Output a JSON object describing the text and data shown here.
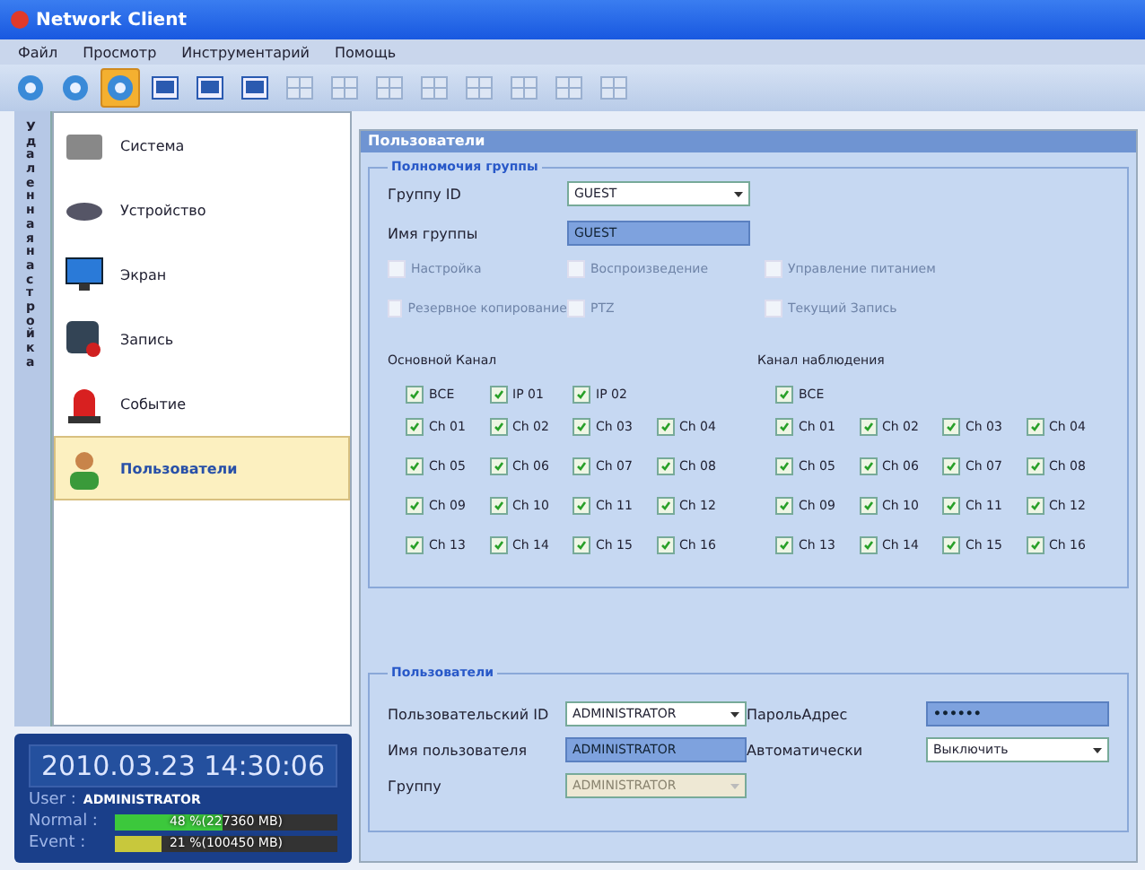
{
  "window": {
    "title": "Network Client"
  },
  "menu": [
    "Файл",
    "Просмотр",
    "Инструментарий",
    "Помощь"
  ],
  "toolbar": [
    {
      "kind": "main",
      "selected": false
    },
    {
      "kind": "main",
      "selected": false
    },
    {
      "kind": "main",
      "selected": true
    },
    {
      "kind": "view",
      "selected": false
    },
    {
      "kind": "view",
      "selected": false
    },
    {
      "kind": "view",
      "selected": false
    },
    {
      "kind": "layout",
      "selected": false
    },
    {
      "kind": "layout",
      "selected": false
    },
    {
      "kind": "layout",
      "selected": false
    },
    {
      "kind": "layout",
      "selected": false
    },
    {
      "kind": "layout",
      "selected": false
    },
    {
      "kind": "layout",
      "selected": false
    },
    {
      "kind": "layout",
      "selected": false
    },
    {
      "kind": "layout",
      "selected": false
    }
  ],
  "side_tab": {
    "label": "Удаленная настройка"
  },
  "sidebar": {
    "items": [
      {
        "label": "Система",
        "kind": "system",
        "selected": false
      },
      {
        "label": "Устройство",
        "kind": "device",
        "selected": false
      },
      {
        "label": "Экран",
        "kind": "screen",
        "selected": false
      },
      {
        "label": "Запись",
        "kind": "record",
        "selected": false
      },
      {
        "label": "Событие",
        "kind": "event",
        "selected": false
      },
      {
        "label": "Пользователи",
        "kind": "user",
        "selected": true
      }
    ]
  },
  "status": {
    "datetime": "2010.03.23  14:30:06",
    "user_label": "User :",
    "user": "ADMINISTRATOR",
    "meters": [
      {
        "label": "Normal :",
        "reading": "48 %(227360 MB)",
        "level": 0.48,
        "color": "#3cc83c"
      },
      {
        "label": "Event   :",
        "reading": "21 %(100450 MB)",
        "level": 0.21,
        "color": "#c8c83c"
      }
    ]
  },
  "panel": {
    "title": "Пользователи",
    "group": {
      "title": "Полномочия группы",
      "group_id": {
        "label": "Группу ID",
        "value": "GUEST"
      },
      "group_name": {
        "label": "Имя группы",
        "value": "GUEST"
      },
      "permissions": [
        {
          "label": "Настройка",
          "checked": false,
          "disabled": true
        },
        {
          "label": "Воспроизведение",
          "checked": false,
          "disabled": true
        },
        {
          "label": "Управление питанием",
          "checked": false,
          "disabled": true
        },
        {
          "label": "Резервное копирование",
          "checked": false,
          "disabled": true
        },
        {
          "label": "PTZ",
          "checked": false,
          "disabled": true
        },
        {
          "label": "Текущий Запись",
          "checked": false,
          "disabled": true
        }
      ],
      "channel_sets": [
        {
          "title": "Основной Канал",
          "top": [
            {
              "label": "ВСЕ",
              "checked": true
            },
            {
              "label": "IP 01",
              "checked": true
            },
            {
              "label": "IP 02",
              "checked": true
            }
          ],
          "channels": [
            {
              "label": "Ch 01",
              "checked": true
            },
            {
              "label": "Ch 02",
              "checked": true
            },
            {
              "label": "Ch 03",
              "checked": true
            },
            {
              "label": "Ch 04",
              "checked": true
            },
            {
              "label": "Ch 05",
              "checked": true
            },
            {
              "label": "Ch 06",
              "checked": true
            },
            {
              "label": "Ch 07",
              "checked": true
            },
            {
              "label": "Ch 08",
              "checked": true
            },
            {
              "label": "Ch 09",
              "checked": true
            },
            {
              "label": "Ch 10",
              "checked": true
            },
            {
              "label": "Ch 11",
              "checked": true
            },
            {
              "label": "Ch 12",
              "checked": true
            },
            {
              "label": "Ch 13",
              "checked": true
            },
            {
              "label": "Ch 14",
              "checked": true
            },
            {
              "label": "Ch 15",
              "checked": true
            },
            {
              "label": "Ch 16",
              "checked": true
            }
          ]
        },
        {
          "title": "Канал наблюдения",
          "top": [
            {
              "label": "ВСЕ",
              "checked": true
            }
          ],
          "channels": [
            {
              "label": "Ch 01",
              "checked": true
            },
            {
              "label": "Ch 02",
              "checked": true
            },
            {
              "label": "Ch 03",
              "checked": true
            },
            {
              "label": "Ch 04",
              "checked": true
            },
            {
              "label": "Ch 05",
              "checked": true
            },
            {
              "label": "Ch 06",
              "checked": true
            },
            {
              "label": "Ch 07",
              "checked": true
            },
            {
              "label": "Ch 08",
              "checked": true
            },
            {
              "label": "Ch 09",
              "checked": true
            },
            {
              "label": "Ch 10",
              "checked": true
            },
            {
              "label": "Ch 11",
              "checked": true
            },
            {
              "label": "Ch 12",
              "checked": true
            },
            {
              "label": "Ch 13",
              "checked": true
            },
            {
              "label": "Ch 14",
              "checked": true
            },
            {
              "label": "Ch 15",
              "checked": true
            },
            {
              "label": "Ch 16",
              "checked": true
            }
          ]
        }
      ]
    },
    "users": {
      "title": "Пользователи",
      "fields": [
        {
          "label": "Пользовательский ID",
          "value": "ADMINISTRATOR",
          "kind": "select",
          "disabled": false
        },
        {
          "label": "ПарольАдрес",
          "value": "••••••",
          "kind": "password"
        },
        {
          "label": "Имя пользователя",
          "value": "ADMINISTRATOR",
          "kind": "text"
        },
        {
          "label": "Автоматически",
          "value": "Выключить",
          "kind": "select",
          "disabled": false
        },
        {
          "label": "Группу",
          "value": "ADMINISTRATOR",
          "kind": "select",
          "disabled": true
        }
      ]
    }
  }
}
